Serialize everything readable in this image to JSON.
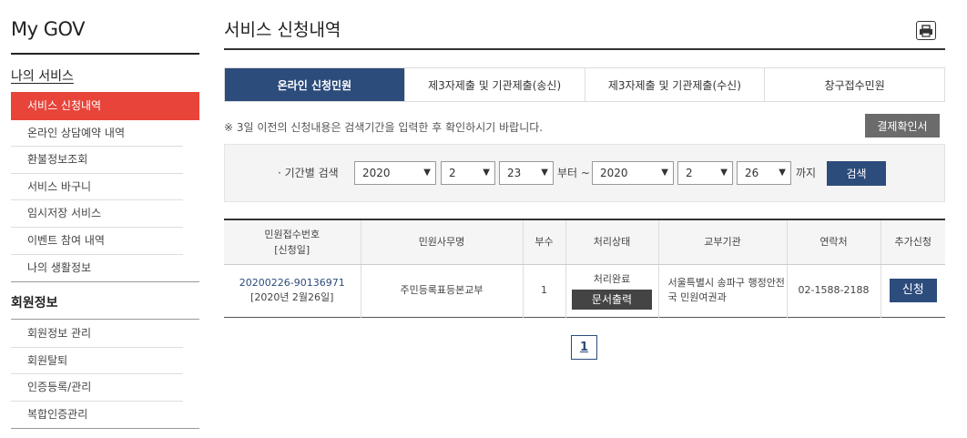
{
  "sidebar": {
    "brand": "My GOV",
    "section1_title": "나의 서비스",
    "services": [
      {
        "label": "서비스 신청내역",
        "active": true
      },
      {
        "label": "온라인 상담예약 내역"
      },
      {
        "label": "환불정보조회"
      },
      {
        "label": "서비스 바구니"
      },
      {
        "label": "임시저장 서비스"
      },
      {
        "label": "이벤트 참여 내역"
      },
      {
        "label": "나의 생활정보"
      }
    ],
    "section2_title": "회원정보",
    "members": [
      {
        "label": "회원정보 관리"
      },
      {
        "label": "회원탈퇴"
      },
      {
        "label": "인증등록/관리"
      },
      {
        "label": "복합인증관리"
      }
    ]
  },
  "main": {
    "title": "서비스 신청내역",
    "print_icon": "printer-icon",
    "tabs": [
      {
        "label": "온라인 신청민원",
        "active": true
      },
      {
        "label": "제3자제출 및 기관제출(송신)"
      },
      {
        "label": "제3자제출 및 기관제출(수신)"
      },
      {
        "label": "창구접수민원"
      }
    ],
    "notice": "※ 3일 이전의 신청내용은 검색기간을 입력한 후 확인하시기 바랍니다.",
    "confirm_button": "결제확인서",
    "search": {
      "label": "· 기간별 검색",
      "from_year": "2020",
      "from_month": "2",
      "from_day": "23",
      "from_text": "부터 ~",
      "to_year": "2020",
      "to_month": "2",
      "to_day": "26",
      "to_text": "까지",
      "button": "검색"
    },
    "table": {
      "headers": {
        "receipt_line1": "민원접수번호",
        "receipt_line2": "[신청일]",
        "name": "민원사무명",
        "copies": "부수",
        "status": "처리상태",
        "agency": "교부기관",
        "contact": "연락처",
        "extra": "추가신청"
      },
      "rows": [
        {
          "receipt_no": "20200226-90136971",
          "date": "[2020년 2월26일]",
          "name": "주민등록표등본교부",
          "copies": "1",
          "status": "처리완료",
          "print_button": "문서출력",
          "agency": "서울특별시 송파구 행정안전국 민원여권과",
          "contact": "02-1588-2188",
          "apply_button": "신청"
        }
      ]
    },
    "pager": {
      "current": "1"
    }
  }
}
